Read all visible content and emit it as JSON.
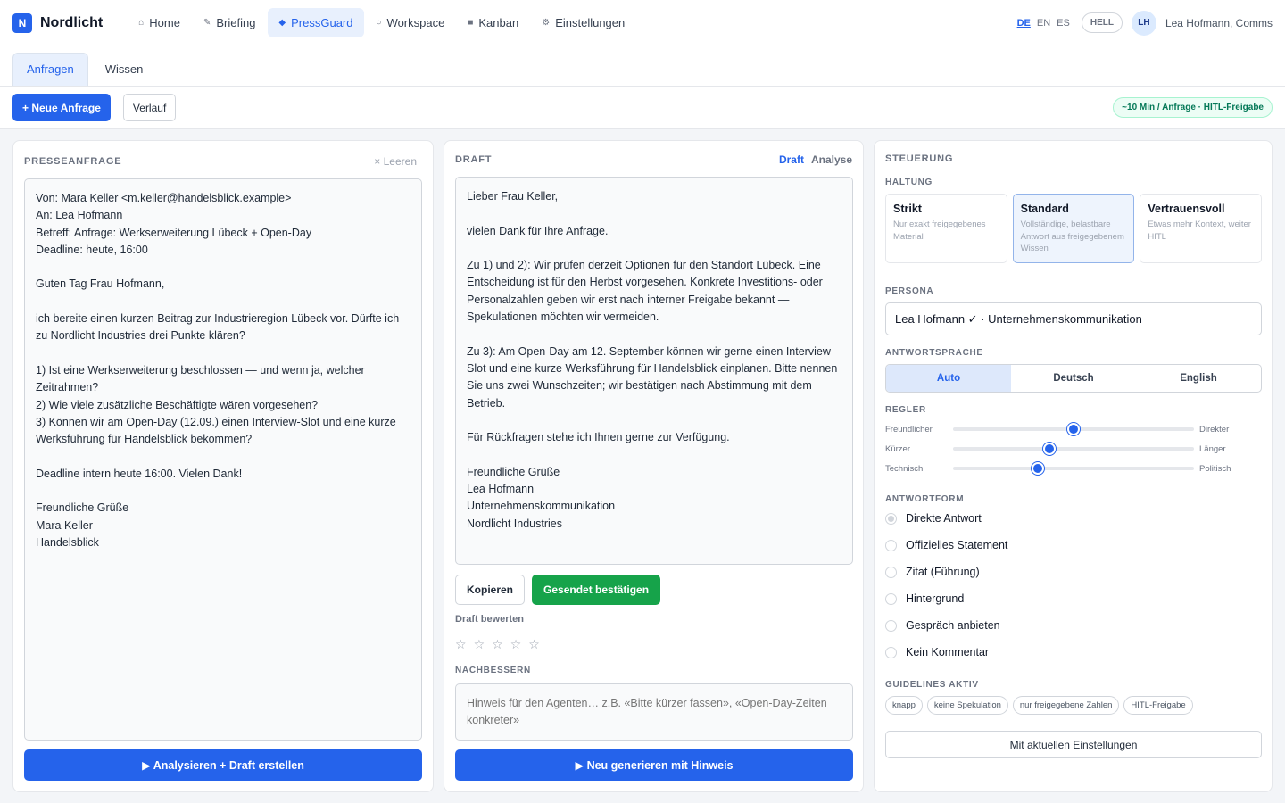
{
  "app": {
    "logo_letter": "N",
    "name": "Nordlicht"
  },
  "nav": [
    {
      "label": "Home",
      "icon": "⌂"
    },
    {
      "label": "Briefing",
      "icon": "✎"
    },
    {
      "label": "PressGuard",
      "icon": "◆"
    },
    {
      "label": "Workspace",
      "icon": "○"
    },
    {
      "label": "Kanban",
      "icon": "■"
    },
    {
      "label": "Einstellungen",
      "icon": "⚙"
    }
  ],
  "header": {
    "langs": [
      "DE",
      "EN",
      "ES"
    ],
    "theme_label": "HELL",
    "avatar_initials": "LH",
    "user_label": "Lea Hofmann, Comms"
  },
  "subtabs": [
    "Anfragen",
    "Wissen"
  ],
  "actions": {
    "new_request": "+ Neue Anfrage",
    "history": "Verlauf",
    "badge": "~10 Min / Anfrage · HITL-Freigabe"
  },
  "request_panel": {
    "title": "PRESSEANFRAGE",
    "clear_label": "× Leeren",
    "text": "Von: Mara Keller <m.keller@handelsblick.example>\nAn: Lea Hofmann\nBetreff: Anfrage: Werkserweiterung Lübeck + Open-Day\nDeadline: heute, 16:00\n\nGuten Tag Frau Hofmann,\n\nich bereite einen kurzen Beitrag zur Industrieregion Lübeck vor. Dürfte ich zu Nordlicht Industries drei Punkte klären?\n\n1) Ist eine Werkserweiterung beschlossen — und wenn ja, welcher Zeitrahmen?\n2) Wie viele zusätzliche Beschäftigte wären vorgesehen?\n3) Können wir am Open-Day (12.09.) einen Interview-Slot und eine kurze Werksführung für Handelsblick bekommen?\n\nDeadline intern heute 16:00. Vielen Dank!\n\nFreundliche Grüße\nMara Keller\nHandelsblick",
    "button": "▶ Analysieren + Draft erstellen"
  },
  "draft_panel": {
    "title": "DRAFT",
    "view_draft": "Draft",
    "view_analysis": "Analyse",
    "text": "Lieber Frau Keller,\n\nvielen Dank für Ihre Anfrage.\n\nZu 1) und 2): Wir prüfen derzeit Optionen für den Standort Lübeck. Eine Entscheidung ist für den Herbst vorgesehen. Konkrete Investitions- oder Personalzahlen geben wir erst nach interner Freigabe bekannt — Spekulationen möchten wir vermeiden.\n\nZu 3): Am Open-Day am 12. September können wir gerne einen Interview-Slot und eine kurze Werksführung für Handelsblick einplanen. Bitte nennen Sie uns zwei Wunschzeiten; wir bestätigen nach Abstimmung mit dem Betrieb.\n\nFür Rückfragen stehe ich Ihnen gerne zur Verfügung.\n\nFreundliche Grüße\nLea Hofmann\nUnternehmenskommunikation\nNordlicht Industries",
    "copy_label": "Kopieren",
    "confirm_label": "Gesendet bestätigen",
    "rate_label": "Draft bewerten",
    "rating": 0,
    "rating_max": 5,
    "fix_title": "NACHBESSERN",
    "fix_placeholder": "Hinweis für den Agenten… z.B. «Bitte kürzer fassen», «Open-Day-Zeiten konkreter»",
    "button": "▶ Neu generieren mit Hinweis"
  },
  "control_panel": {
    "title": "STEUERUNG",
    "stance_title": "HALTUNG",
    "stances": [
      {
        "name": "Strikt",
        "desc": "Nur exakt freigegebenes Material"
      },
      {
        "name": "Standard",
        "desc": "Vollständige, belastbare Antwort aus freigegebenem Wissen"
      },
      {
        "name": "Vertrauensvoll",
        "desc": "Etwas mehr Kontext, weiter HITL"
      }
    ],
    "stance_selected": "Standard",
    "persona_title": "PERSONA",
    "persona_value": "Lea Hofmann ✓ · Unternehmenskommunikation",
    "lang_title": "ANTWORTSPRACHE",
    "lang_options": [
      "Auto",
      "Deutsch",
      "English"
    ],
    "lang_selected": "Auto",
    "regler_title": "REGLER",
    "sliders": [
      {
        "left": "Freundlicher",
        "right": "Direkter",
        "value": 0.5
      },
      {
        "left": "Kürzer",
        "right": "Länger",
        "value": 0.4
      },
      {
        "left": "Technisch",
        "right": "Politisch",
        "value": 0.35
      }
    ],
    "form_title": "ANTWORTFORM",
    "forms": [
      "Direkte Antwort",
      "Offizielles Statement",
      "Zitat (Führung)",
      "Hintergrund",
      "Gespräch anbieten",
      "Kein Kommentar"
    ],
    "form_selected": "Direkte Antwort",
    "guidelines_title": "GUIDELINES AKTIV",
    "guidelines": [
      "knapp",
      "keine Spekulation",
      "nur freigegebene Zahlen",
      "HITL-Freigabe"
    ],
    "apply_label": "Mit aktuellen Einstellungen"
  }
}
